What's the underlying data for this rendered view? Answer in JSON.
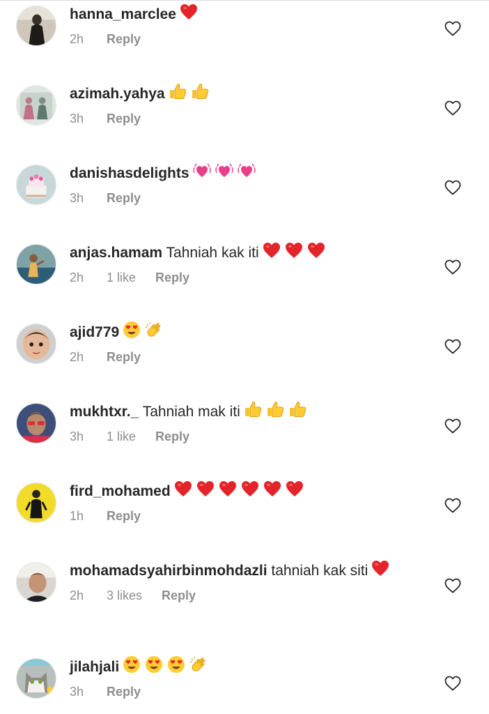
{
  "comments": [
    {
      "username": "hanna_marclee",
      "text": "",
      "emojis": [
        "red-heart"
      ],
      "time": "2h",
      "likes": "",
      "reply": "Reply",
      "avatar": "person-dark"
    },
    {
      "username": "azimah.yahya",
      "text": "",
      "emojis": [
        "thumbs-up",
        "thumbs-up"
      ],
      "time": "3h",
      "likes": "",
      "reply": "Reply",
      "avatar": "group-photo"
    },
    {
      "username": "danishasdelights",
      "text": "",
      "emojis": [
        "growing-heart",
        "growing-heart",
        "growing-heart"
      ],
      "time": "3h",
      "likes": "",
      "reply": "Reply",
      "avatar": "cake"
    },
    {
      "username": "anjas.hamam",
      "text": "Tahniah kak iti",
      "emojis": [
        "red-heart",
        "red-heart",
        "red-heart"
      ],
      "time": "2h",
      "likes": "1 like",
      "reply": "Reply",
      "avatar": "child-outdoor"
    },
    {
      "username": "ajid779",
      "text": "",
      "emojis": [
        "heart-eyes",
        "clapping"
      ],
      "time": "2h",
      "likes": "",
      "reply": "Reply",
      "avatar": "toddler-face"
    },
    {
      "username": "mukhtxr._",
      "text": "Tahniah mak iti",
      "emojis": [
        "thumbs-up",
        "thumbs-up",
        "thumbs-up"
      ],
      "time": "3h",
      "likes": "1 like",
      "reply": "Reply",
      "avatar": "man-sunglasses"
    },
    {
      "username": "fird_mohamed",
      "text": "",
      "emojis": [
        "red-heart",
        "red-heart",
        "red-heart",
        "red-heart",
        "red-heart",
        "red-heart"
      ],
      "time": "1h",
      "likes": "",
      "reply": "Reply",
      "avatar": "person-yellow"
    },
    {
      "username": "mohamadsyahirbinmohdazli",
      "text": "tahniah kak siti",
      "emojis": [
        "red-heart"
      ],
      "time": "2h",
      "likes": "3 likes",
      "reply": "Reply",
      "avatar": "man-selfie"
    },
    {
      "username": "jilahjali",
      "text": "",
      "emojis": [
        "heart-eyes",
        "heart-eyes",
        "heart-eyes",
        "clapping"
      ],
      "time": "3h",
      "likes": "",
      "reply": "Reply",
      "avatar": "cat"
    }
  ],
  "icons": {
    "like": "heart-outline-icon"
  },
  "colors": {
    "username": "#262626",
    "meta": "#8e8e8e",
    "heart": "#e0245e"
  }
}
